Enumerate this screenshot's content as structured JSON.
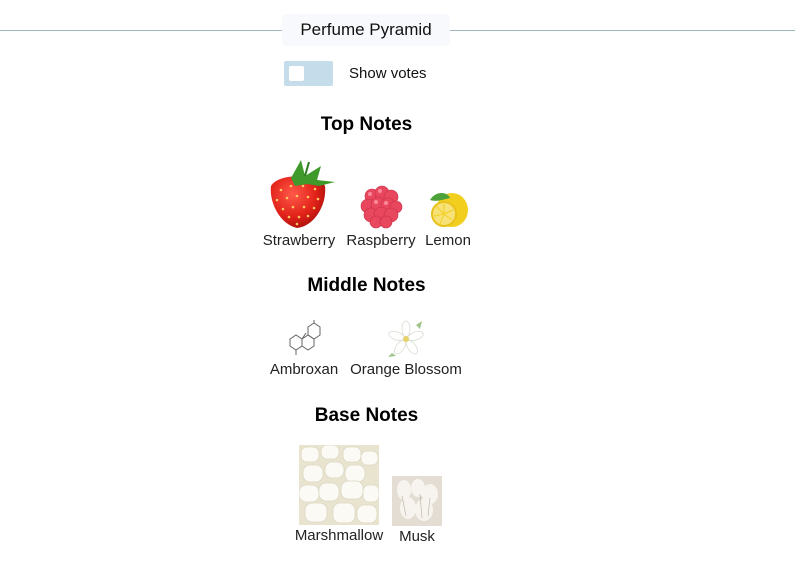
{
  "header": {
    "title": "Perfume Pyramid"
  },
  "toggle": {
    "label": "Show votes",
    "checked": false,
    "track_color": "#c5dceb"
  },
  "sections": [
    {
      "heading": "Top Notes",
      "notes": [
        {
          "label": "Strawberry",
          "icon": "strawberry-icon"
        },
        {
          "label": "Raspberry",
          "icon": "raspberry-icon"
        },
        {
          "label": "Lemon",
          "icon": "lemon-icon"
        }
      ]
    },
    {
      "heading": "Middle Notes",
      "notes": [
        {
          "label": "Ambroxan",
          "icon": "molecule-icon"
        },
        {
          "label": "Orange Blossom",
          "icon": "blossom-icon"
        }
      ]
    },
    {
      "heading": "Base Notes",
      "notes": [
        {
          "label": "Marshmallow",
          "icon": "marshmallow-icon"
        },
        {
          "label": "Musk",
          "icon": "musk-icon"
        }
      ]
    }
  ]
}
